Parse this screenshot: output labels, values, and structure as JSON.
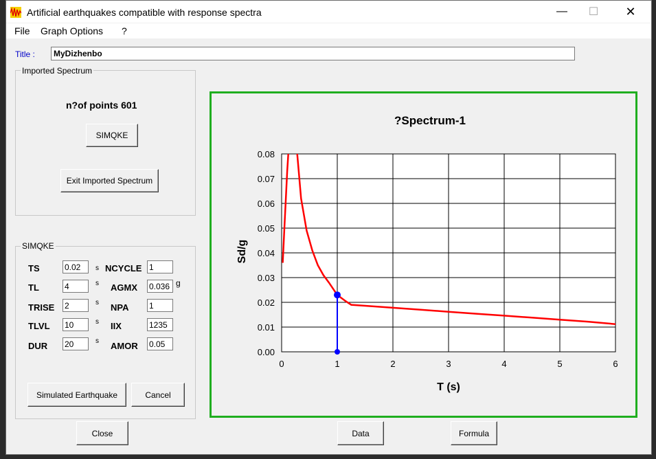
{
  "window": {
    "title": "Artificial earthquakes compatible with response spectra",
    "minimize_glyph": "—",
    "maximize_glyph": "☐",
    "close_glyph": "✕",
    "app_icon": "waveform-icon"
  },
  "menu": [
    "File",
    "Graph Options",
    "?"
  ],
  "title_field": {
    "label": "Title :",
    "value": "MyDizhenbo"
  },
  "imported_spectrum": {
    "group_title": "Imported Spectrum",
    "points_text": "n?of points 601",
    "simqke_button": "SIMQKE",
    "exit_button": "Exit Imported Spectrum"
  },
  "simqke": {
    "group_title": "SIMQKE",
    "left_params": [
      {
        "label": "TS",
        "value": "0.02",
        "unit": "s"
      },
      {
        "label": "TL",
        "value": "4",
        "unit": "s"
      },
      {
        "label": "TRISE",
        "value": "2",
        "unit": "s"
      },
      {
        "label": "TLVL",
        "value": "10",
        "unit": "s"
      },
      {
        "label": "DUR",
        "value": "20",
        "unit": "s"
      }
    ],
    "right_params": [
      {
        "label": "NCYCLE",
        "value": "1",
        "unit": ""
      },
      {
        "label": "AGMX",
        "value": "0.036",
        "unit": "g"
      },
      {
        "label": "NPA",
        "value": "1",
        "unit": ""
      },
      {
        "label": "IIX",
        "value": "1235",
        "unit": ""
      },
      {
        "label": "AMOR",
        "value": "0.05",
        "unit": ""
      }
    ],
    "simulate_button": "Simulated Earthquake",
    "cancel_button": "Cancel"
  },
  "bottom_buttons": {
    "close": "Close",
    "data": "Data",
    "formula": "Formula"
  },
  "colors": {
    "chart_border": "#1fae1f",
    "series": "#ff0000",
    "marker": "#0000ff",
    "title_label": "#0000c8"
  },
  "chart_data": {
    "type": "line",
    "title": "?Spectrum-1",
    "xlabel": "T (s)",
    "ylabel": "Sd/g",
    "xlim": [
      0,
      6
    ],
    "ylim": [
      0,
      0.08
    ],
    "xticks": [
      "0",
      "1",
      "2",
      "3",
      "4",
      "5",
      "6"
    ],
    "yticks": [
      "0.00",
      "0.01",
      "0.02",
      "0.03",
      "0.04",
      "0.05",
      "0.06",
      "0.07",
      "0.08"
    ],
    "grid": true,
    "series": [
      {
        "x": [
          0.02,
          0.05,
          0.1,
          0.12,
          0.15,
          0.2,
          0.25,
          0.28,
          0.35,
          0.45,
          0.55,
          0.65,
          0.75,
          0.85,
          1.0,
          1.15,
          1.25,
          1.5,
          2.0,
          2.5,
          3.0,
          3.5,
          4.0,
          4.5,
          5.0,
          5.5,
          6.0
        ],
        "y": [
          0.036,
          0.05,
          0.073,
          0.08,
          0.09,
          0.09,
          0.088,
          0.08,
          0.062,
          0.049,
          0.041,
          0.035,
          0.031,
          0.028,
          0.023,
          0.0205,
          0.019,
          0.0186,
          0.0178,
          0.017,
          0.0162,
          0.0154,
          0.0146,
          0.0138,
          0.013,
          0.0122,
          0.0112
        ]
      }
    ],
    "marker": {
      "x": 1.0,
      "y": 0.023
    }
  }
}
